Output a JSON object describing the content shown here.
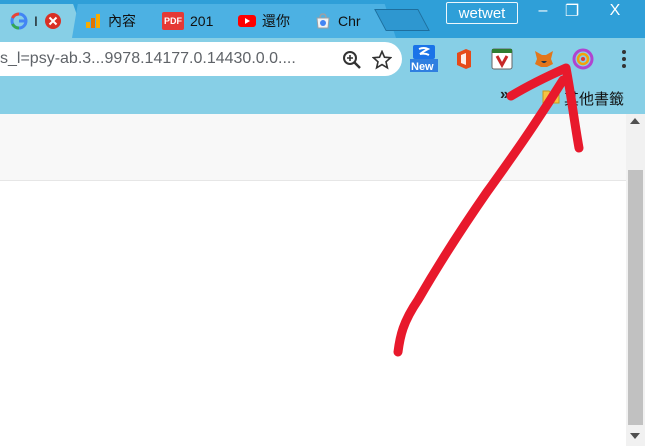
{
  "tabs": [
    {
      "label": "I",
      "favicon": "google-g-icon",
      "close": "close-red-icon"
    },
    {
      "label": "內容",
      "favicon": "analytics-icon"
    },
    {
      "label": "201",
      "favicon": "pdf-icon",
      "badge": "PDF"
    },
    {
      "label": "還你",
      "favicon": "youtube-icon"
    },
    {
      "label": "Chr",
      "favicon": "chrome-web-store-icon"
    }
  ],
  "window": {
    "profile_name": "wetwet",
    "minimize": "–",
    "restore": "❐",
    "close": "X"
  },
  "toolbar": {
    "url": "s_l=psy-ab.3...9978.14177.0.14430.0.0....",
    "zoom_icon": "zoom-icon",
    "star_icon": "star-icon",
    "extensions": [
      {
        "name": "new-extension-icon",
        "badge": "New"
      },
      {
        "name": "office-icon"
      },
      {
        "name": "mcafee-icon"
      },
      {
        "name": "metamask-icon"
      },
      {
        "name": "color-circle-extension-icon"
      }
    ],
    "menu_icon": "kebab-menu-icon"
  },
  "bookmarks": {
    "overflow": "»",
    "folder_label": "其他書籤"
  },
  "colors": {
    "tabstrip": "#2f9fd8",
    "toolbar": "#87cfe6",
    "annotation_arrow": "#e8192c"
  }
}
